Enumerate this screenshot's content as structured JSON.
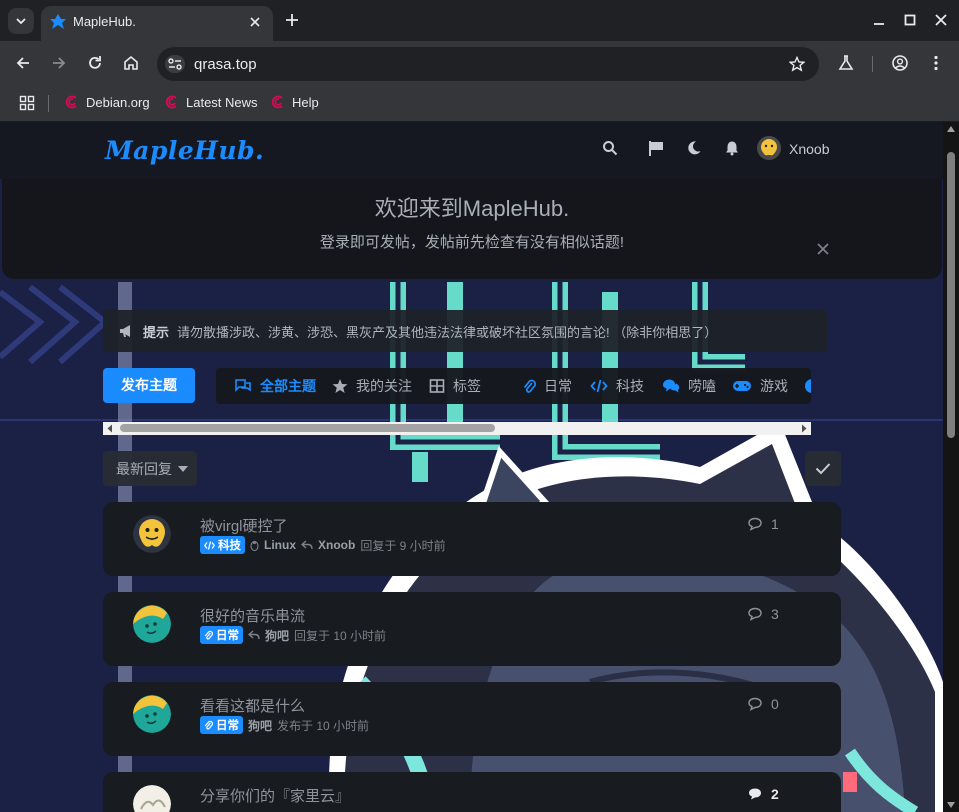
{
  "browser": {
    "tab_title": "MapleHub.",
    "url": "qrasa.top",
    "bookmarks": [
      {
        "label": "Debian.org"
      },
      {
        "label": "Latest News"
      },
      {
        "label": "Help"
      }
    ]
  },
  "site": {
    "logo": "MapleHub.",
    "username": "Xnoob",
    "welcome_title": "欢迎来到MapleHub.",
    "welcome_subtitle": "登录即可发帖，发帖前先检查有没有相似话题!",
    "notice_label": "提示",
    "notice_text": "请勿散播涉政、涉黄、涉恐、黑灰产及其他违法法律或破坏社区氛围的言论! （除非你相思了）",
    "post_button": "发布主题",
    "tags": [
      {
        "label": "全部主题",
        "icon": "comments-icon"
      },
      {
        "label": "我的关注",
        "icon": "star-icon"
      },
      {
        "label": "标签",
        "icon": "grid-icon"
      },
      {
        "label": "日常",
        "icon": "paperclip-icon"
      },
      {
        "label": "科技",
        "icon": "code-icon"
      },
      {
        "label": "唠嗑",
        "icon": "chat-icon"
      },
      {
        "label": "游戏",
        "icon": "gamepad-icon"
      }
    ],
    "sort_label": "最新回复"
  },
  "discussions": [
    {
      "title": "被virgl硬控了",
      "tag": "科技",
      "sub_tag": "Linux",
      "user": "Xnoob",
      "action": "回复于 9 小时前",
      "replies": "1"
    },
    {
      "title": "很好的音乐串流",
      "tag": "日常",
      "sub_tag": "",
      "user": "狗吧",
      "action": "回复于 10 小时前",
      "replies": "3"
    },
    {
      "title": "看看这都是什么",
      "tag": "日常",
      "sub_tag": "",
      "user": "狗吧",
      "action": "发布于 10 小时前",
      "replies": "0"
    },
    {
      "title": "分享你们的『家里云』",
      "tag": "",
      "sub_tag": "",
      "user": "",
      "action": "",
      "replies": "2"
    }
  ],
  "colors": {
    "accent": "#1a8cff",
    "page_bg": "#1b2045",
    "card_bg": "#181b20"
  }
}
